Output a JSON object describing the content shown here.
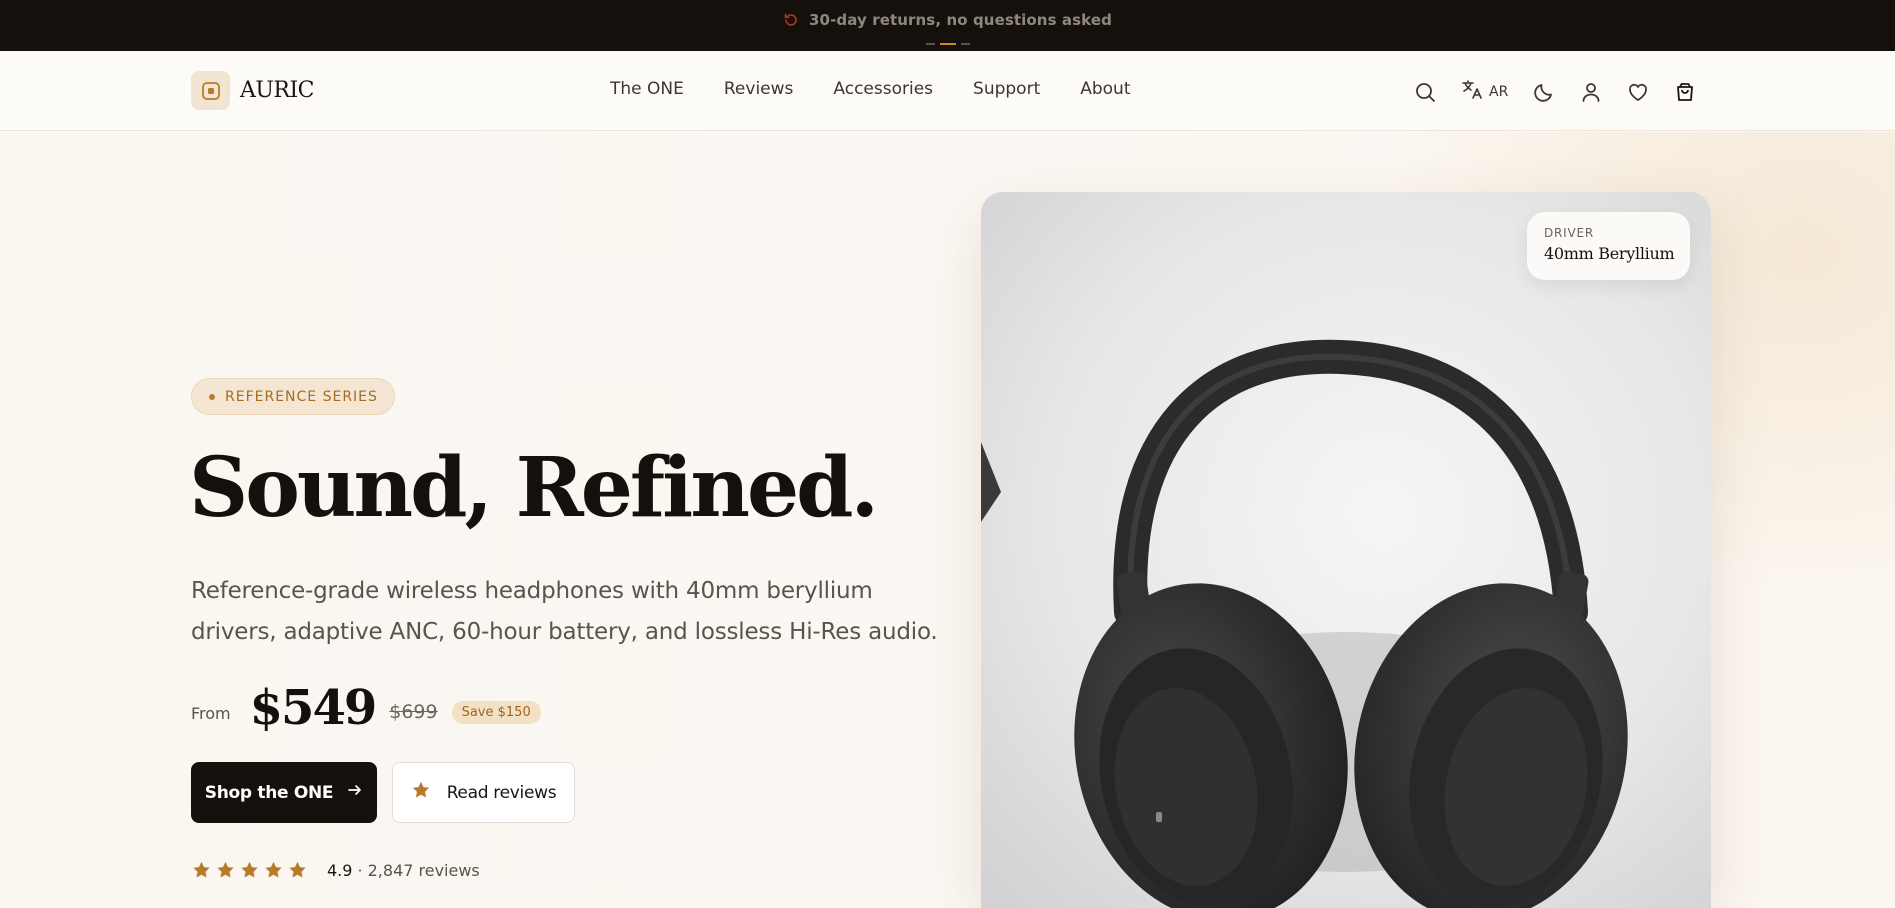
{
  "announcement": {
    "text": "30-day returns, no questions asked",
    "icon": "refresh-icon",
    "slides": 3,
    "active_slide": 2
  },
  "brand": {
    "name": "AURIC"
  },
  "nav": {
    "items": [
      "The ONE",
      "Reviews",
      "Accessories",
      "Support",
      "About"
    ]
  },
  "header_icons": {
    "language": "AR"
  },
  "hero": {
    "badge": "REFERENCE SERIES",
    "headline": "Sound, Refined.",
    "subtitle": "Reference-grade wireless headphones with 40mm beryllium drivers, adaptive ANC, 60-hour battery, and lossless Hi-Res audio.",
    "price_prefix": "From",
    "price": "$549",
    "original_price": "$699",
    "save_badge": "Save $150",
    "primary_cta": "Shop the ONE",
    "secondary_cta": "Read reviews",
    "rating_stars": 5,
    "rating_score": "4.9",
    "rating_count": "· 2,847 reviews"
  },
  "spec_card": {
    "label": "DRIVER",
    "value": "40mm Beryllium"
  },
  "colors": {
    "accent": "#b97a2a",
    "dark": "#16100c",
    "badge_bg": "#f4e6d2"
  }
}
